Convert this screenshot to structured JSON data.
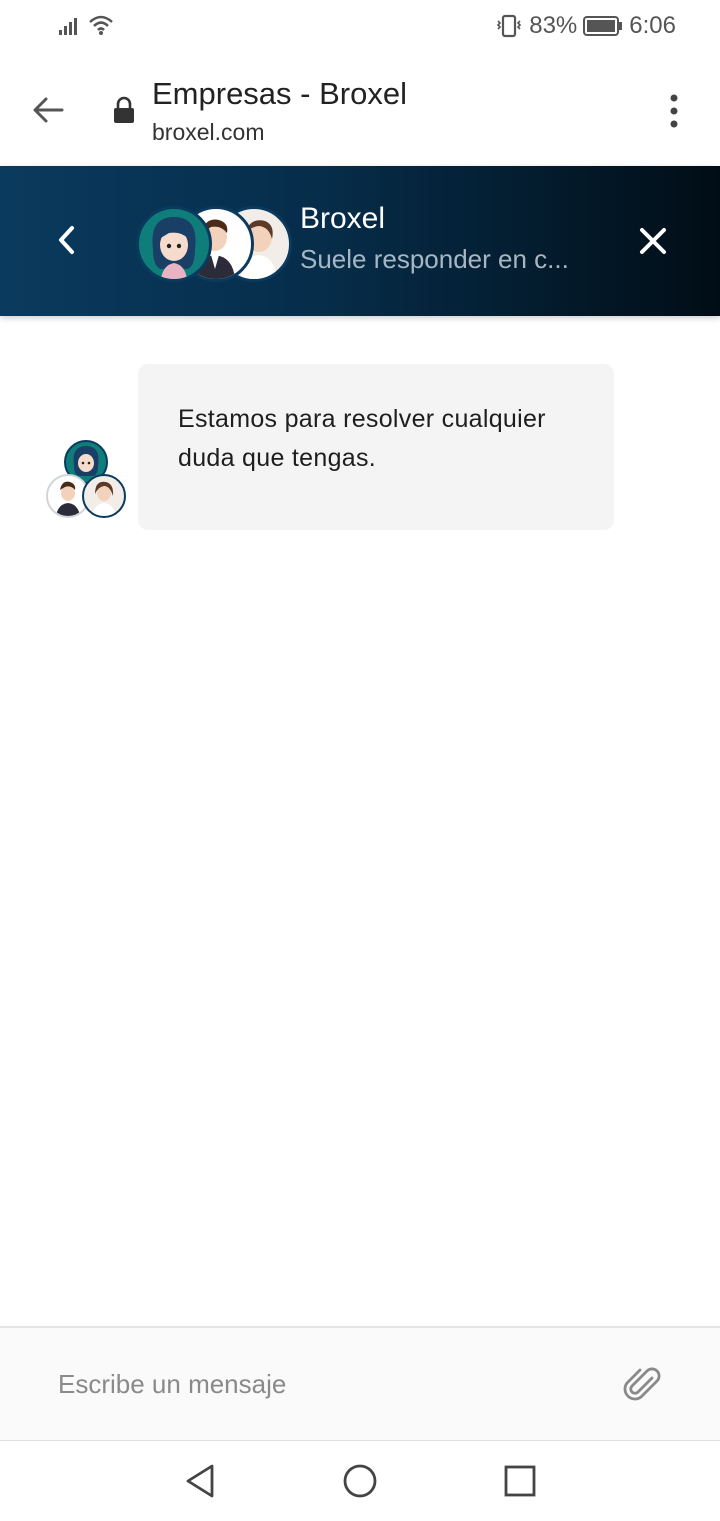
{
  "status_bar": {
    "battery": "83%",
    "time": "6:06",
    "icons": [
      "signal-icon",
      "wifi-icon",
      "vibrate-icon",
      "battery-icon"
    ]
  },
  "browser": {
    "page_title": "Empresas - Broxel",
    "url": "broxel.com",
    "icons": [
      "back-arrow-icon",
      "lock-icon",
      "more-vert-icon"
    ]
  },
  "chat": {
    "header": {
      "name": "Broxel",
      "subtitle": "Suele responder en c...",
      "icons": [
        "chevron-left-icon",
        "close-icon"
      ]
    },
    "messages": [
      {
        "text": "Estamos para resolver cualquier duda que tengas."
      }
    ],
    "composer": {
      "placeholder": "Escribe un mensaje",
      "icons": [
        "paperclip-icon"
      ]
    }
  },
  "navbar": {
    "icons": [
      "nav-back-icon",
      "nav-home-icon",
      "nav-recents-icon"
    ]
  },
  "colors": {
    "header_gradient_start": "#0a3a5e",
    "header_gradient_end": "#010d16",
    "bubble_bg": "#f4f4f4"
  }
}
